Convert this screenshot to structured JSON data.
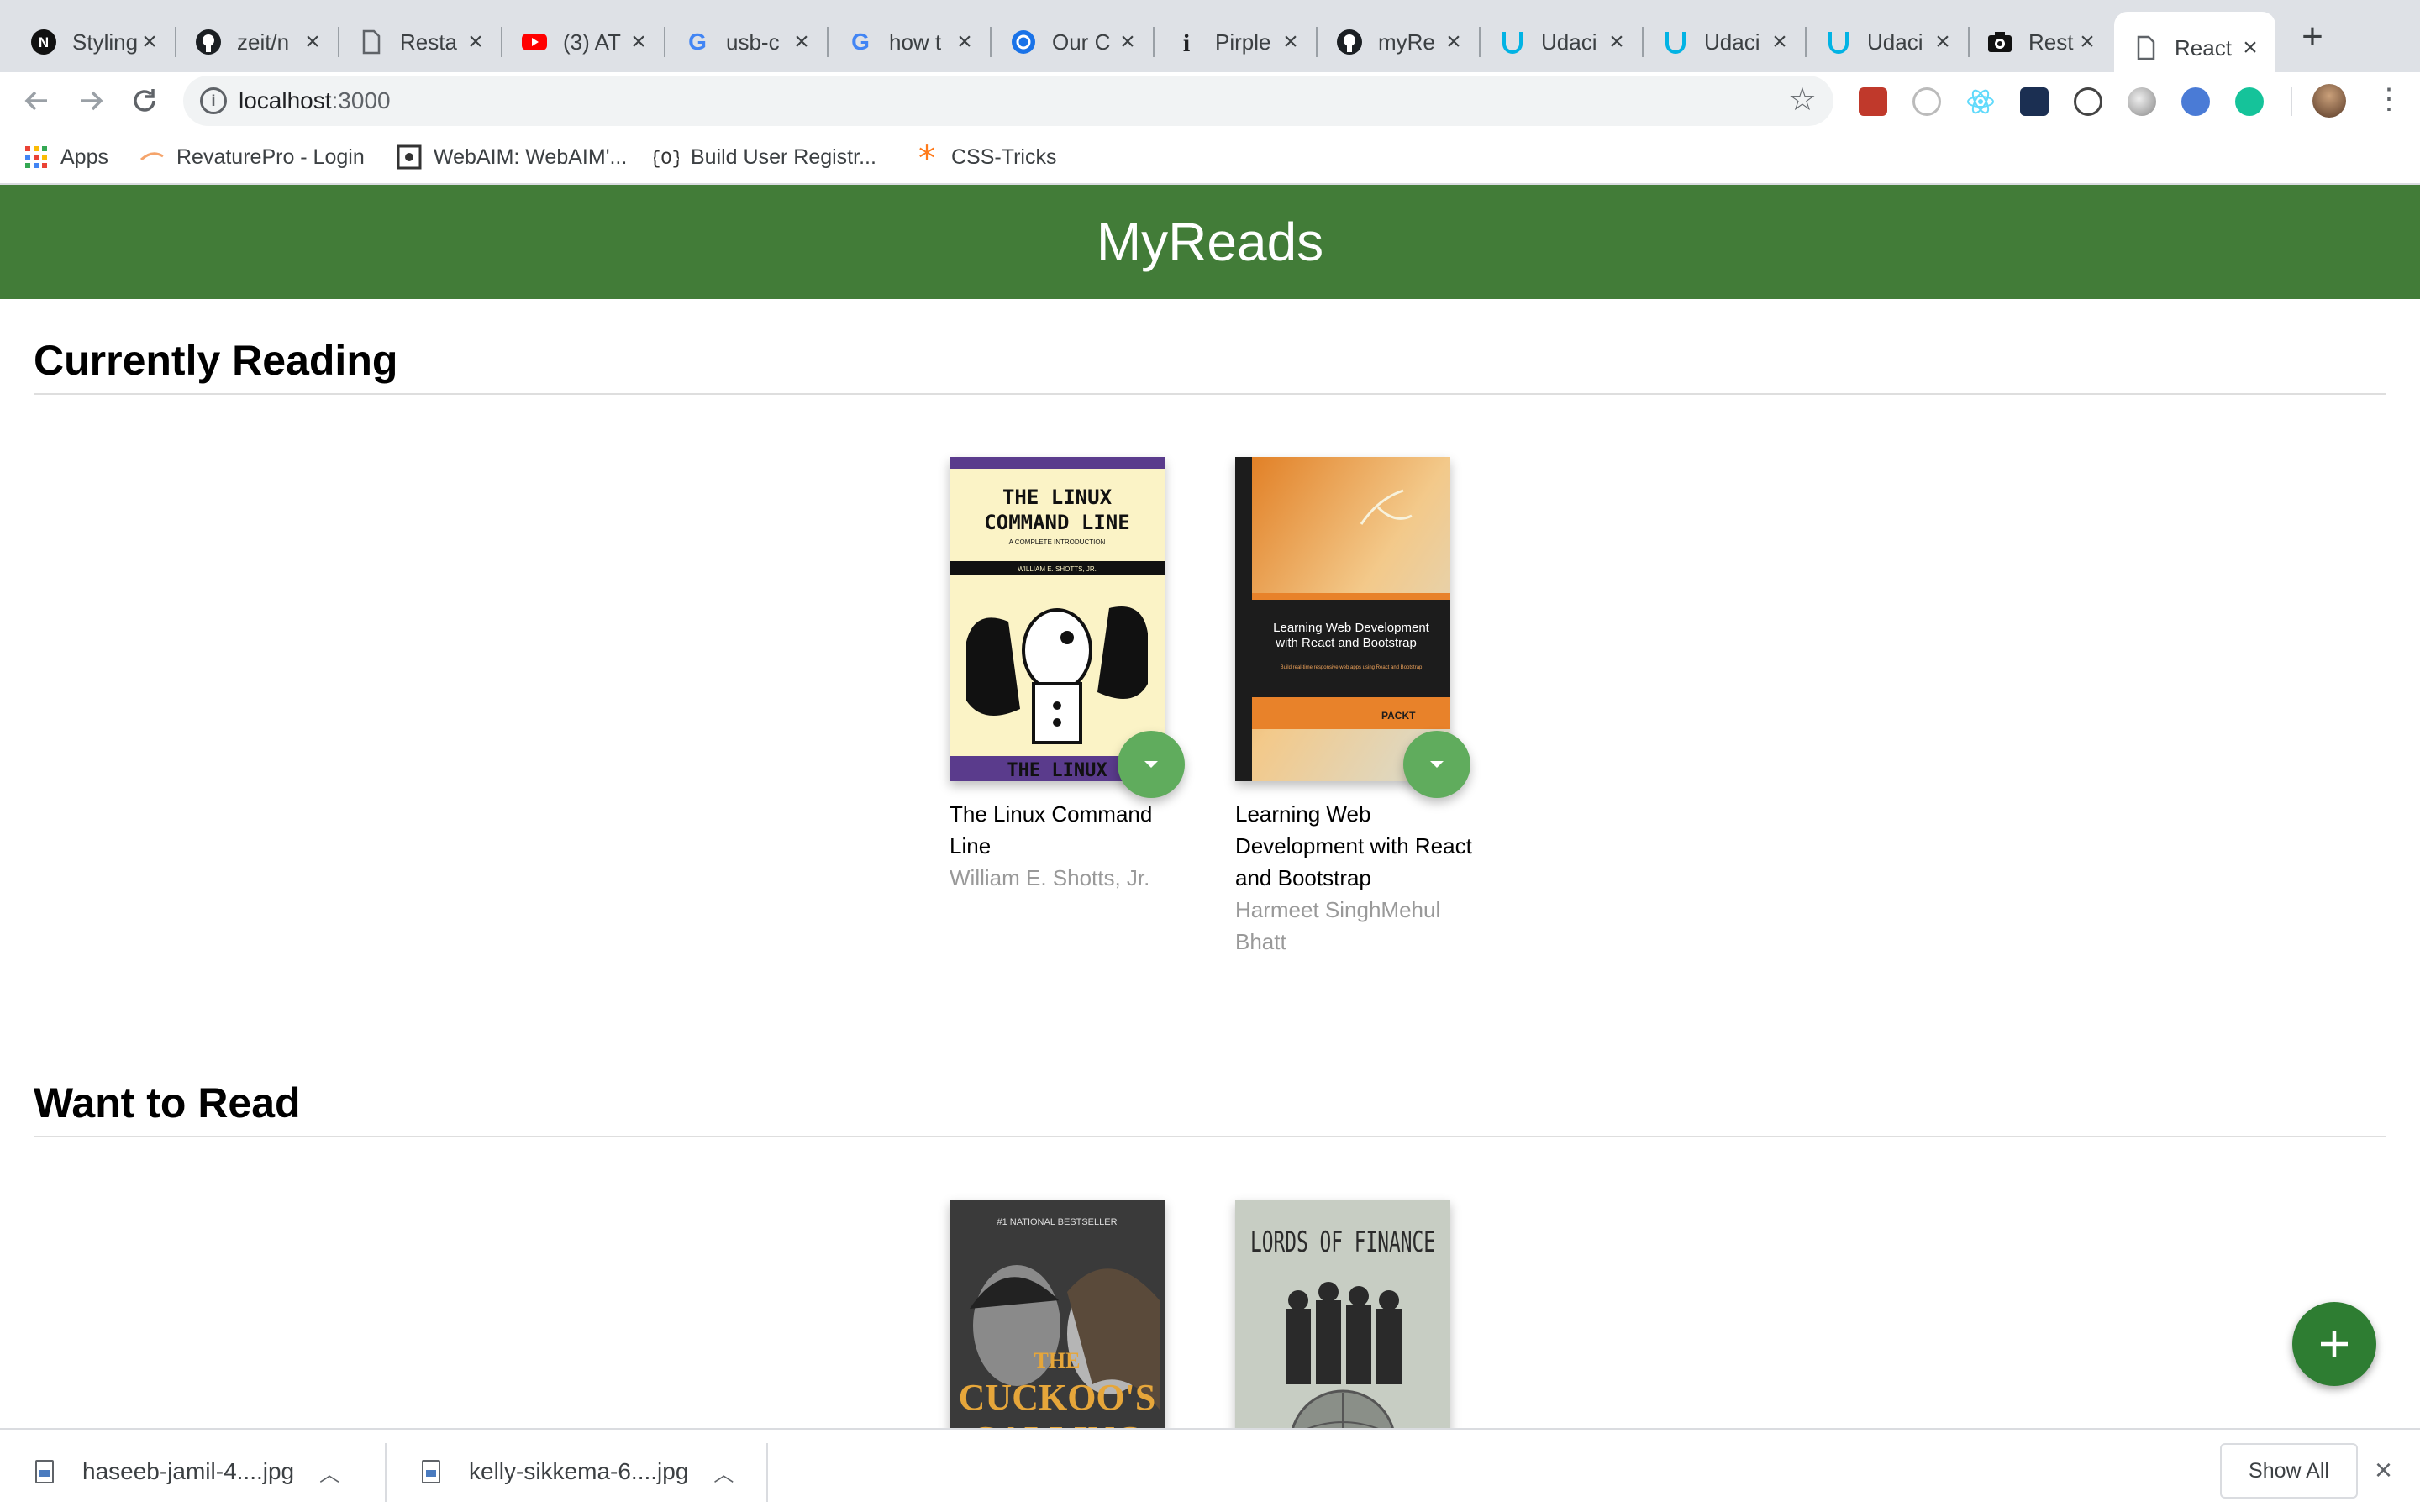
{
  "browser": {
    "tabs": [
      {
        "title": "Styling",
        "icon": "notion-icon"
      },
      {
        "title": "zeit/n",
        "icon": "github-icon"
      },
      {
        "title": "Resta",
        "icon": "document-icon"
      },
      {
        "title": "(3) AT",
        "icon": "youtube-icon"
      },
      {
        "title": "usb-c",
        "icon": "google-icon"
      },
      {
        "title": "how t",
        "icon": "google-icon"
      },
      {
        "title": "Our C",
        "icon": "globe-icon"
      },
      {
        "title": "Pirple",
        "icon": "info-icon"
      },
      {
        "title": "myRe",
        "icon": "github-icon"
      },
      {
        "title": "Udaci",
        "icon": "udacity-icon"
      },
      {
        "title": "Udaci",
        "icon": "udacity-icon"
      },
      {
        "title": "Udaci",
        "icon": "udacity-icon"
      },
      {
        "title": "Restu",
        "icon": "camera-icon"
      },
      {
        "title": "React",
        "icon": "document-icon"
      }
    ],
    "address": {
      "host": "localhost",
      "port": ":3000"
    },
    "bookmarks": [
      {
        "label": "Apps",
        "icon": "apps-grid-icon"
      },
      {
        "label": "RevaturePro - Login",
        "icon": "revature-icon"
      },
      {
        "label": "WebAIM: WebAIM'...",
        "icon": "webaim-icon"
      },
      {
        "label": "Build User Registr...",
        "icon": "code-brackets-icon"
      },
      {
        "label": "CSS-Tricks",
        "icon": "asterisk-icon"
      }
    ]
  },
  "app": {
    "title": "MyReads",
    "shelves": [
      {
        "title": "Currently Reading",
        "books": [
          {
            "title": "The Linux Command Line",
            "authors": "William E. Shotts, Jr.",
            "cover_text": [
              "THE LINUX",
              "COMMAND LINE",
              "A COMPLETE INTRODUCTION",
              "WILLIAM E. SHOTTS, JR.",
              "THE LINUX"
            ]
          },
          {
            "title": "Learning Web Development with React and Bootstrap",
            "authors": "Harmeet SinghMehul Bhatt",
            "cover_text": [
              "Learning Web Development",
              "with React and Bootstrap",
              "Build real-time responsive web apps using React and Bootstrap",
              "PACKT"
            ]
          }
        ]
      },
      {
        "title": "Want to Read",
        "books": [
          {
            "title": "",
            "authors": "",
            "cover_text": [
              "#1 NATIONAL BESTSELLER",
              "THE",
              "CUCKOO'S",
              "CALLING"
            ]
          },
          {
            "title": "",
            "authors": "",
            "cover_text": [
              "LORDS OF FINANCE"
            ]
          }
        ]
      }
    ]
  },
  "downloads": {
    "items": [
      {
        "name": "haseeb-jamil-4....jpg"
      },
      {
        "name": "kelly-sikkema-6....jpg"
      }
    ],
    "show_all": "Show All"
  },
  "colors": {
    "header_green": "#427c38",
    "shelf_changer_green": "#60ac5d",
    "add_button_green": "#2e7d32"
  }
}
